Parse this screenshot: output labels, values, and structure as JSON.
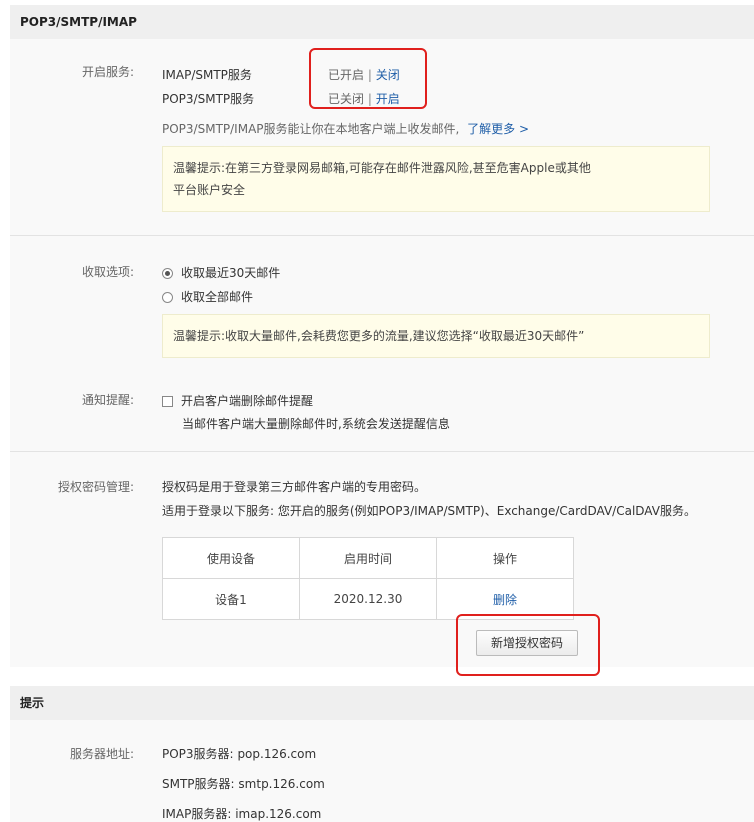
{
  "section1": {
    "title": "POP3/SMTP/IMAP",
    "services_label": "开启服务:",
    "services": [
      {
        "name": "IMAP/SMTP服务",
        "status": "已开启",
        "sep": "|",
        "action": "关闭"
      },
      {
        "name": "POP3/SMTP服务",
        "status": "已关闭",
        "sep": "|",
        "action": "开启"
      }
    ],
    "desc": "POP3/SMTP/IMAP服务能让你在本地客户端上收发邮件,",
    "learn_more": "了解更多 >",
    "warning": {
      "line1": "温馨提示:在第三方登录网易邮箱,可能存在邮件泄露风险,甚至危害Apple或其他",
      "line2": "平台账户安全"
    },
    "receive_label": "收取选项:",
    "receive_options": [
      {
        "label": "收取最近30天邮件",
        "checked": true
      },
      {
        "label": "收取全部邮件",
        "checked": false
      }
    ],
    "receive_tip": "温馨提示:收取大量邮件,会耗费您更多的流量,建议您选择“收取最近30天邮件”",
    "notify_label": "通知提醒:",
    "notify_option": "开启客户端删除邮件提醒",
    "notify_desc": "当邮件客户端大量删除邮件时,系统会发送提醒信息",
    "auth_label": "授权密码管理:",
    "auth_desc1": "授权码是用于登录第三方邮件客户端的专用密码。",
    "auth_desc2": "适用于登录以下服务: 您开启的服务(例如POP3/IMAP/SMTP)、Exchange/CardDAV/CalDAV服务。",
    "table": {
      "headers": [
        "使用设备",
        "启用时间",
        "操作"
      ],
      "rows": [
        {
          "device": "设备1",
          "time": "2020.12.30",
          "action": "删除"
        }
      ]
    },
    "add_button": "新增授权密码"
  },
  "section2": {
    "title": "提示",
    "server_label": "服务器地址:",
    "servers": [
      {
        "name": "POP3服务器:",
        "value": "pop.126.com"
      },
      {
        "name": "SMTP服务器:",
        "value": "smtp.126.com"
      },
      {
        "name": "IMAP服务器:",
        "value": "imap.126.com"
      }
    ]
  },
  "colors": {
    "link": "#1f5ea8",
    "highlight": "#e0201d",
    "tip_bg": "#fffde9"
  }
}
